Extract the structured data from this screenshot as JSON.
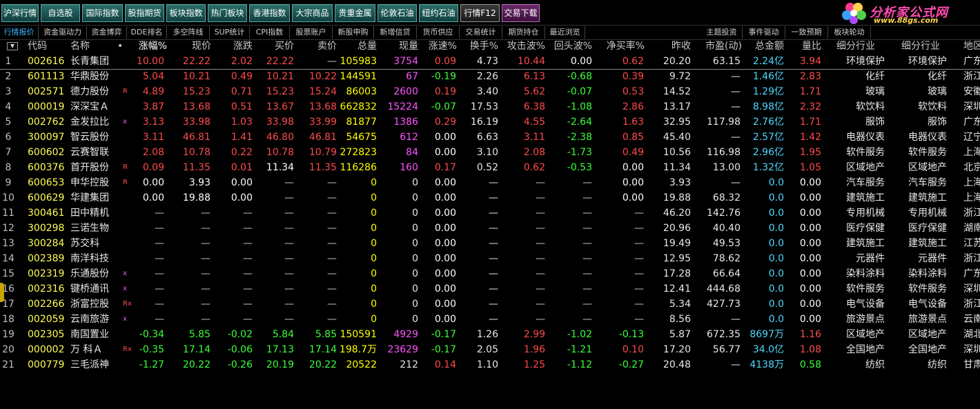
{
  "toolbar": {
    "buttons": [
      "沪深行情",
      "自选股",
      "国际指数",
      "股指期货",
      "板块指数",
      "热门板块",
      "香港指数",
      "大宗商品",
      "贵重金属",
      "伦敦石油",
      "纽约石油",
      "行情F12",
      "交易下载"
    ],
    "active": "行情F12",
    "trade": "交易下载"
  },
  "logo": {
    "title": "分析家公式网",
    "url": "www.88gs.com"
  },
  "tabs": [
    "行情报价",
    "资金驱动力",
    "资金博弈",
    "DDE排名",
    "多空阵线",
    "SUP统计",
    "CPI指数",
    "股票账户",
    "新股申购",
    "新增信贷",
    "货币供应",
    "交易统计",
    "期货持仓",
    "最近浏览",
    "主题投资",
    "事件驱动",
    "一致预期",
    "板块轮动"
  ],
  "columns": [
    "代码",
    "名称",
    "•",
    "涨幅%",
    "现价",
    "涨跌",
    "买价",
    "卖价",
    "总量",
    "现量",
    "涨速%",
    "换手%",
    "攻击波%",
    "回头波%",
    "净买率%",
    "昨收",
    "市盈(动)",
    "总金额",
    "量比",
    "细分行业",
    "细分行业",
    "地区"
  ],
  "rows": [
    {
      "i": "1",
      "code": "002616",
      "name": "长青集团",
      "flag": "",
      "chg": "10.00",
      "price": "22.22",
      "diff": "2.02",
      "bid": "22.22",
      "ask": "—",
      "vol": "105983",
      "cur": "3754",
      "spd": "0.09",
      "turn": "4.73",
      "atk": "10.44",
      "back": "0.00",
      "net": "0.62",
      "prev": "20.20",
      "pe": "63.15",
      "amt": "2.24亿",
      "ratio": "3.94",
      "ind1": "环境保护",
      "ind2": "环境保护",
      "reg": "广东",
      "tone": "red"
    },
    {
      "i": "2",
      "code": "601113",
      "name": "华鼎股份",
      "flag": "",
      "chg": "5.04",
      "price": "10.21",
      "diff": "0.49",
      "bid": "10.21",
      "ask": "10.22",
      "vol": "144591",
      "cur": "67",
      "spd": "-0.19",
      "turn": "2.26",
      "atk": "6.13",
      "back": "-0.68",
      "net": "0.39",
      "prev": "9.72",
      "pe": "—",
      "amt": "1.46亿",
      "ratio": "2.83",
      "ind1": "化纤",
      "ind2": "化纤",
      "reg": "浙江",
      "tone": "red"
    },
    {
      "i": "3",
      "code": "002571",
      "name": "德力股份",
      "flag": "R",
      "chg": "4.89",
      "price": "15.23",
      "diff": "0.71",
      "bid": "15.23",
      "ask": "15.24",
      "vol": "86003",
      "cur": "2600",
      "spd": "0.19",
      "turn": "3.40",
      "atk": "5.62",
      "back": "-0.07",
      "net": "0.53",
      "prev": "14.52",
      "pe": "—",
      "amt": "1.29亿",
      "ratio": "1.71",
      "ind1": "玻璃",
      "ind2": "玻璃",
      "reg": "安徽",
      "tone": "red"
    },
    {
      "i": "4",
      "code": "000019",
      "name": "深深宝Ａ",
      "flag": "",
      "chg": "3.87",
      "price": "13.68",
      "diff": "0.51",
      "bid": "13.67",
      "ask": "13.68",
      "vol": "662832",
      "cur": "15224",
      "spd": "-0.07",
      "turn": "17.53",
      "atk": "6.38",
      "back": "-1.08",
      "net": "2.86",
      "prev": "13.17",
      "pe": "—",
      "amt": "8.98亿",
      "ratio": "2.32",
      "ind1": "软饮料",
      "ind2": "软饮料",
      "reg": "深圳",
      "tone": "red"
    },
    {
      "i": "5",
      "code": "002762",
      "name": "金发拉比",
      "flag": "x",
      "chg": "3.13",
      "price": "33.98",
      "diff": "1.03",
      "bid": "33.98",
      "ask": "33.99",
      "vol": "81877",
      "cur": "1386",
      "spd": "0.29",
      "turn": "16.19",
      "atk": "4.55",
      "back": "-2.64",
      "net": "1.63",
      "prev": "32.95",
      "pe": "117.98",
      "amt": "2.76亿",
      "ratio": "1.71",
      "ind1": "服饰",
      "ind2": "服饰",
      "reg": "广东",
      "tone": "red"
    },
    {
      "i": "6",
      "code": "300097",
      "name": "智云股份",
      "flag": "",
      "chg": "3.11",
      "price": "46.81",
      "diff": "1.41",
      "bid": "46.80",
      "ask": "46.81",
      "vol": "54675",
      "cur": "612",
      "spd": "0.00",
      "turn": "6.63",
      "atk": "3.11",
      "back": "-2.38",
      "net": "0.85",
      "prev": "45.40",
      "pe": "—",
      "amt": "2.57亿",
      "ratio": "1.42",
      "ind1": "电器仪表",
      "ind2": "电器仪表",
      "reg": "辽宁",
      "tone": "red"
    },
    {
      "i": "7",
      "code": "600602",
      "name": "云赛智联",
      "flag": "",
      "chg": "2.08",
      "price": "10.78",
      "diff": "0.22",
      "bid": "10.78",
      "ask": "10.79",
      "vol": "272823",
      "cur": "84",
      "spd": "0.00",
      "turn": "3.10",
      "atk": "2.08",
      "back": "-1.73",
      "net": "0.49",
      "prev": "10.56",
      "pe": "116.98",
      "amt": "2.96亿",
      "ratio": "1.95",
      "ind1": "软件服务",
      "ind2": "软件服务",
      "reg": "上海",
      "tone": "red"
    },
    {
      "i": "8",
      "code": "600376",
      "name": "首开股份",
      "flag": "R",
      "chg": "0.09",
      "price": "11.35",
      "diff": "0.01",
      "bid": "11.34",
      "ask": "11.35",
      "vol": "116286",
      "cur": "160",
      "spd": "0.17",
      "turn": "0.52",
      "atk": "0.62",
      "back": "-0.53",
      "net": "0.00",
      "prev": "11.34",
      "pe": "13.00",
      "amt": "1.32亿",
      "ratio": "1.05",
      "ind1": "区域地产",
      "ind2": "区域地产",
      "reg": "北京",
      "tone": "red",
      "bidWhite": true
    },
    {
      "i": "9",
      "code": "600653",
      "name": "申华控股",
      "flag": "R",
      "chg": "0.00",
      "price": "3.93",
      "diff": "0.00",
      "bid": "—",
      "ask": "—",
      "vol": "0",
      "cur": "0",
      "spd": "0.00",
      "turn": "—",
      "atk": "—",
      "back": "—",
      "net": "0.00",
      "prev": "3.93",
      "pe": "—",
      "amt": "0.0",
      "ratio": "0.00",
      "ind1": "汽车服务",
      "ind2": "汽车服务",
      "reg": "上海",
      "tone": "wht"
    },
    {
      "i": "10",
      "code": "600629",
      "name": "华建集团",
      "flag": "",
      "chg": "0.00",
      "price": "19.88",
      "diff": "0.00",
      "bid": "—",
      "ask": "—",
      "vol": "0",
      "cur": "0",
      "spd": "0.00",
      "turn": "—",
      "atk": "—",
      "back": "—",
      "net": "0.00",
      "prev": "19.88",
      "pe": "68.32",
      "amt": "0.0",
      "ratio": "0.00",
      "ind1": "建筑施工",
      "ind2": "建筑施工",
      "reg": "上海",
      "tone": "wht"
    },
    {
      "i": "11",
      "code": "300461",
      "name": "田中精机",
      "flag": "",
      "chg": "—",
      "price": "—",
      "diff": "—",
      "bid": "—",
      "ask": "—",
      "vol": "0",
      "cur": "0",
      "spd": "0.00",
      "turn": "—",
      "atk": "—",
      "back": "—",
      "net": "—",
      "prev": "46.20",
      "pe": "142.76",
      "amt": "0.0",
      "ratio": "0.00",
      "ind1": "专用机械",
      "ind2": "专用机械",
      "reg": "浙江",
      "tone": "dash"
    },
    {
      "i": "12",
      "code": "300298",
      "name": "三诺生物",
      "flag": "",
      "chg": "—",
      "price": "—",
      "diff": "—",
      "bid": "—",
      "ask": "—",
      "vol": "0",
      "cur": "0",
      "spd": "0.00",
      "turn": "—",
      "atk": "—",
      "back": "—",
      "net": "—",
      "prev": "20.96",
      "pe": "40.40",
      "amt": "0.0",
      "ratio": "0.00",
      "ind1": "医疗保健",
      "ind2": "医疗保健",
      "reg": "湖南",
      "tone": "dash"
    },
    {
      "i": "13",
      "code": "300284",
      "name": "苏交科",
      "flag": "",
      "chg": "—",
      "price": "—",
      "diff": "—",
      "bid": "—",
      "ask": "—",
      "vol": "0",
      "cur": "0",
      "spd": "0.00",
      "turn": "—",
      "atk": "—",
      "back": "—",
      "net": "—",
      "prev": "19.49",
      "pe": "49.53",
      "amt": "0.0",
      "ratio": "0.00",
      "ind1": "建筑施工",
      "ind2": "建筑施工",
      "reg": "江苏",
      "tone": "dash"
    },
    {
      "i": "14",
      "code": "002389",
      "name": "南洋科技",
      "flag": "",
      "chg": "—",
      "price": "—",
      "diff": "—",
      "bid": "—",
      "ask": "—",
      "vol": "0",
      "cur": "0",
      "spd": "0.00",
      "turn": "—",
      "atk": "—",
      "back": "—",
      "net": "—",
      "prev": "12.95",
      "pe": "78.62",
      "amt": "0.0",
      "ratio": "0.00",
      "ind1": "元器件",
      "ind2": "元器件",
      "reg": "浙江",
      "tone": "dash"
    },
    {
      "i": "15",
      "code": "002319",
      "name": "乐通股份",
      "flag": "x",
      "chg": "—",
      "price": "—",
      "diff": "—",
      "bid": "—",
      "ask": "—",
      "vol": "0",
      "cur": "0",
      "spd": "0.00",
      "turn": "—",
      "atk": "—",
      "back": "—",
      "net": "—",
      "prev": "17.28",
      "pe": "66.64",
      "amt": "0.0",
      "ratio": "0.00",
      "ind1": "染料涂料",
      "ind2": "染料涂料",
      "reg": "广东",
      "tone": "dash"
    },
    {
      "i": "16",
      "code": "002316",
      "name": "键桥通讯",
      "flag": "x",
      "chg": "—",
      "price": "—",
      "diff": "—",
      "bid": "—",
      "ask": "—",
      "vol": "0",
      "cur": "0",
      "spd": "0.00",
      "turn": "—",
      "atk": "—",
      "back": "—",
      "net": "—",
      "prev": "12.41",
      "pe": "444.68",
      "amt": "0.0",
      "ratio": "0.00",
      "ind1": "软件服务",
      "ind2": "软件服务",
      "reg": "深圳",
      "tone": "dash"
    },
    {
      "i": "17",
      "code": "002266",
      "name": "浙富控股",
      "flag": "Rx",
      "chg": "—",
      "price": "—",
      "diff": "—",
      "bid": "—",
      "ask": "—",
      "vol": "0",
      "cur": "0",
      "spd": "0.00",
      "turn": "—",
      "atk": "—",
      "back": "—",
      "net": "—",
      "prev": "5.34",
      "pe": "427.73",
      "amt": "0.0",
      "ratio": "0.00",
      "ind1": "电气设备",
      "ind2": "电气设备",
      "reg": "浙江",
      "tone": "dash"
    },
    {
      "i": "18",
      "code": "002059",
      "name": "云南旅游",
      "flag": "x",
      "chg": "—",
      "price": "—",
      "diff": "—",
      "bid": "—",
      "ask": "—",
      "vol": "0",
      "cur": "0",
      "spd": "0.00",
      "turn": "—",
      "atk": "—",
      "back": "—",
      "net": "—",
      "prev": "8.56",
      "pe": "—",
      "amt": "0.0",
      "ratio": "0.00",
      "ind1": "旅游景点",
      "ind2": "旅游景点",
      "reg": "云南",
      "tone": "dash"
    },
    {
      "i": "19",
      "code": "002305",
      "name": "南国置业",
      "flag": "",
      "chg": "-0.34",
      "price": "5.85",
      "diff": "-0.02",
      "bid": "5.84",
      "ask": "5.85",
      "vol": "150591",
      "cur": "4929",
      "spd": "-0.17",
      "turn": "1.26",
      "atk": "2.99",
      "back": "-1.02",
      "net": "-0.13",
      "prev": "5.87",
      "pe": "672.35",
      "amt": "8697万",
      "ratio": "1.16",
      "ind1": "区域地产",
      "ind2": "区域地产",
      "reg": "湖北",
      "tone": "grn"
    },
    {
      "i": "20",
      "code": "000002",
      "name": "万 科Ａ",
      "flag": "Rx",
      "chg": "-0.35",
      "price": "17.14",
      "diff": "-0.06",
      "bid": "17.13",
      "ask": "17.14",
      "vol": "198.7万",
      "cur": "23629",
      "spd": "-0.17",
      "turn": "2.05",
      "atk": "1.96",
      "back": "-1.21",
      "net": "0.10",
      "prev": "17.20",
      "pe": "56.77",
      "amt": "34.0亿",
      "ratio": "1.08",
      "ind1": "全国地产",
      "ind2": "全国地产",
      "reg": "深圳",
      "tone": "grn"
    },
    {
      "i": "21",
      "code": "000779",
      "name": "三毛派神",
      "flag": "",
      "chg": "-1.27",
      "price": "20.22",
      "diff": "-0.26",
      "bid": "20.19",
      "ask": "20.22",
      "vol": "20522",
      "cur": "212",
      "spd": "0.14",
      "turn": "1.10",
      "atk": "1.25",
      "back": "-1.12",
      "net": "-0.27",
      "prev": "20.48",
      "pe": "—",
      "amt": "4138万",
      "ratio": "0.58",
      "ind1": "纺织",
      "ind2": "纺织",
      "reg": "甘肃",
      "tone": "grn"
    }
  ],
  "colors": {
    "up": "#ff4b4b",
    "down": "#3cff3c",
    "volume": "#ffff00",
    "current": "#ff55ff",
    "amount": "#4fd8ff",
    "code": "#ffff55"
  }
}
